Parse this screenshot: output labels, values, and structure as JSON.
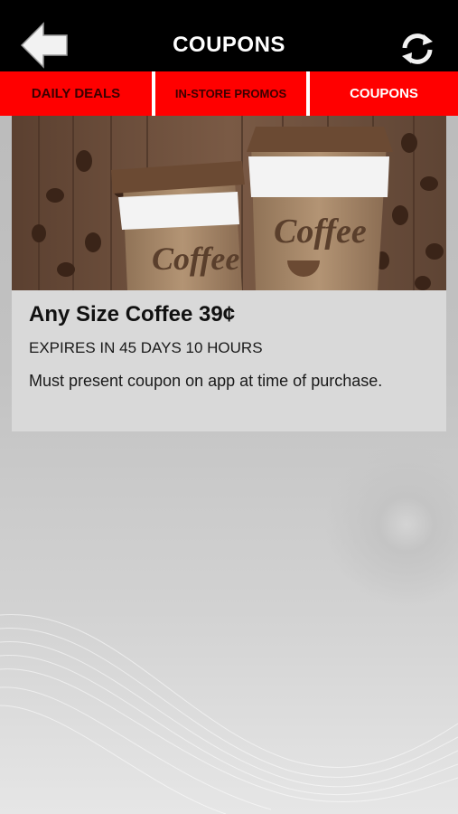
{
  "header": {
    "title": "COUPONS",
    "back_icon": "back-arrow-icon",
    "refresh_icon": "refresh-icon",
    "bg_color": "#000000"
  },
  "tabs": [
    {
      "label": "DAILY DEALS",
      "active": false
    },
    {
      "label": "IN-STORE PROMOS",
      "active": false
    },
    {
      "label": "COUPONS",
      "active": true
    }
  ],
  "tab_colors": {
    "bar": "#ff0000",
    "inactive_text": "#3a0000",
    "active_text": "#ffffff"
  },
  "coupon": {
    "image_text": "Coffee",
    "title": "Any Size Coffee 39¢",
    "expires": "EXPIRES IN 45 DAYS 10 HOURS",
    "description": "Must present coupon on app at time of purchase."
  }
}
